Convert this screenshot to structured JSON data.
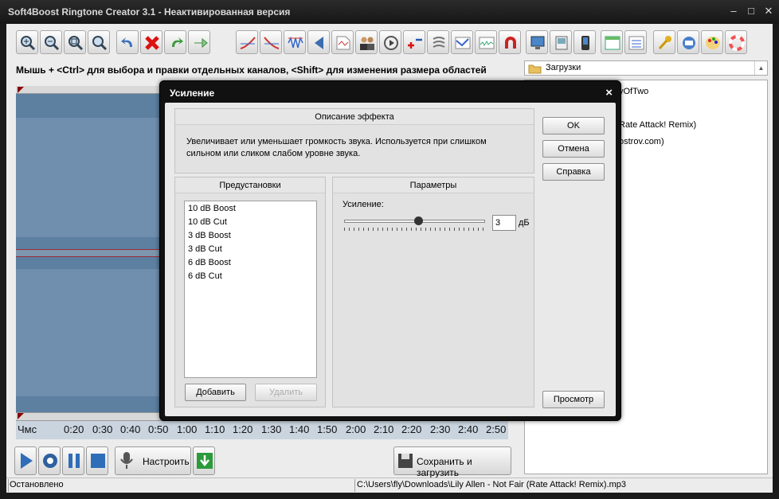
{
  "window": {
    "title": "Soft4Boost Ringtone Creator 3.1 - Неактивированная версия",
    "minimize": "–",
    "maximize": "□",
    "close": "✕"
  },
  "toolbar": {
    "icons": [
      "zoom-in-icon",
      "zoom-out-icon",
      "zoom-fit-icon",
      "zoom-100-icon",
      "undo-icon",
      "delete-icon",
      "redo-icon",
      "forward-icon",
      "fade-in-icon",
      "fade-out-icon",
      "normalize-icon",
      "reverse-icon",
      "silence-icon",
      "people-icon",
      "speed-icon",
      "amplify-icon",
      "echo-icon",
      "equalizer-icon",
      "noise-icon",
      "magnet-icon",
      "monitor-icon",
      "device-icon",
      "phone-icon",
      "frame-icon",
      "list-icon",
      "key-icon",
      "keyboard-icon",
      "palette-icon",
      "help-icon"
    ]
  },
  "hint": "Мышь + <Ctrl> для выбора и правки отдельных каналов, <Shift> для изменения размера областей",
  "timeline": {
    "unit": "Чмс",
    "ticks": [
      "0:20",
      "0:30",
      "0:40",
      "0:50",
      "1:00",
      "1:10",
      "1:20",
      "1:30",
      "1:40",
      "1:50",
      "2:00",
      "2:10",
      "2:20",
      "2:30",
      "2:40",
      "2:50"
    ]
  },
  "controls": {
    "play": "play-icon",
    "record": "record-icon",
    "pause": "pause-icon",
    "stop": "stop-icon",
    "setup_label": "Настроить",
    "save_label": "Сохранить и загрузить"
  },
  "browser": {
    "folder": "Загрузки",
    "files": [
      "yOfTwo",
      "Rate Attack! Remix)",
      "ostrov.com)"
    ]
  },
  "status": {
    "state": "Остановлено",
    "path": "C:\\Users\\fly\\Downloads\\Lily Allen - Not Fair (Rate Attack! Remix).mp3"
  },
  "dialog": {
    "title": "Усиление",
    "close": "×",
    "description_header": "Описание эффекта",
    "description_text": "Увеличивает или уменьшает громкость звука. Используется при слишком сильном или сликом слабом уровне звука.",
    "ok_label": "OK",
    "cancel_label": "Отмена",
    "help_label": "Справка",
    "preview_label": "Просмотр",
    "presets_header": "Предустановки",
    "presets": [
      "10 dB Boost",
      "10 dB Cut",
      "3 dB Boost",
      "3 dB Cut",
      "6 dB Boost",
      "6 dB Cut"
    ],
    "add_label": "Добавить",
    "delete_label": "Удалить",
    "params_header": "Параметры",
    "gain_label": "Усиление:",
    "gain_value": "3",
    "gain_unit": "дБ",
    "gain_slider_fraction": 0.53
  }
}
